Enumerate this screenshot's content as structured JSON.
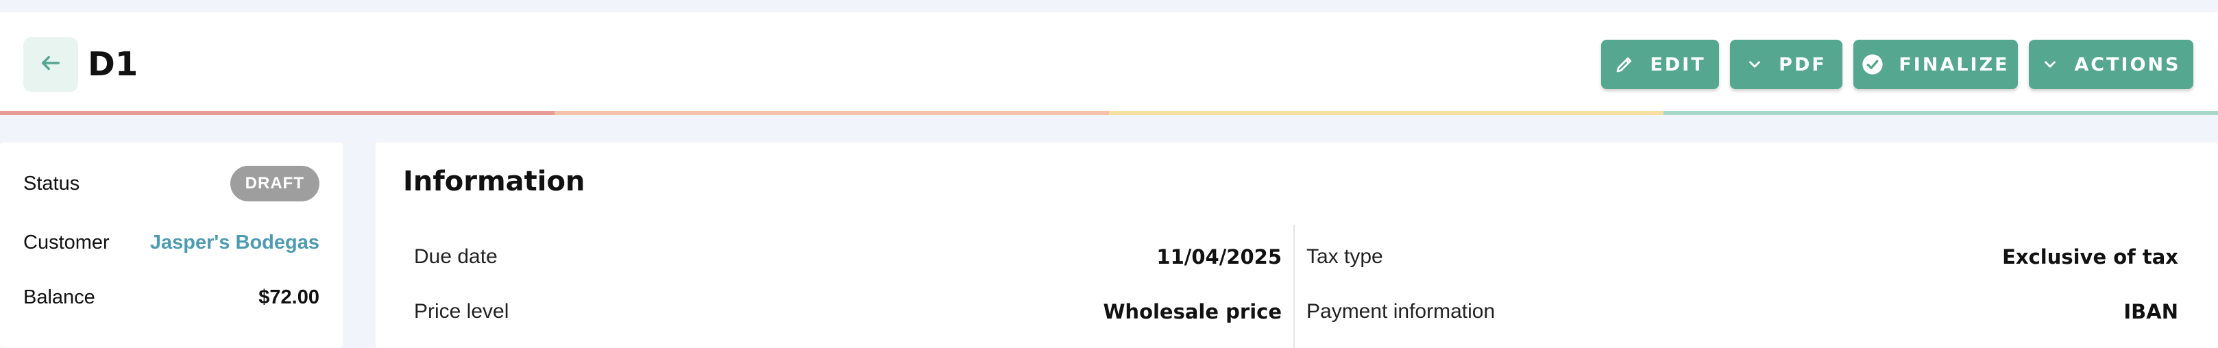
{
  "header": {
    "title": "D1",
    "buttons": {
      "edit": "EDIT",
      "pdf": "PDF",
      "finalize": "FINALIZE",
      "actions": "ACTIONS"
    },
    "progress_colors": [
      "#e79b94",
      "#f3c4a9",
      "#f6dfa3",
      "#a9d8cb"
    ]
  },
  "sidebar": {
    "status_label": "Status",
    "status_badge": "DRAFT",
    "customer_label": "Customer",
    "customer_value": "Jasper's Bodegas",
    "balance_label": "Balance",
    "balance_value": "$72.00"
  },
  "information": {
    "title": "Information",
    "left": [
      {
        "label": "Due date",
        "value": "11/04/2025"
      },
      {
        "label": "Price level",
        "value": "Wholesale price"
      }
    ],
    "right": [
      {
        "label": "Tax type",
        "value": "Exclusive of tax"
      },
      {
        "label": "Payment information",
        "value": "IBAN"
      }
    ]
  },
  "colors": {
    "accent": "#55a78f",
    "link": "#4e9bb0",
    "badge": "#9e9e9e",
    "background": "#f2f4fb"
  }
}
